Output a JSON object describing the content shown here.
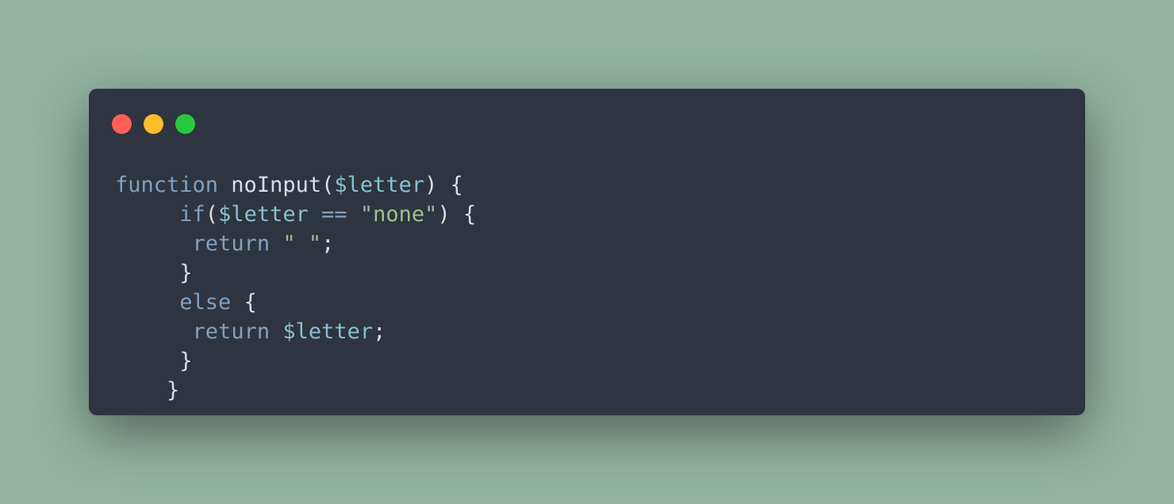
{
  "colors": {
    "background": "#94b3a2",
    "window": "#2e3440",
    "light_red": "#ff5f56",
    "light_yellow": "#ffbd2e",
    "light_green": "#27c93f",
    "keyword": "#81a1c1",
    "variable": "#88c0d0",
    "string": "#a3be8c",
    "plain": "#d8dee9"
  },
  "code": {
    "lines": [
      {
        "indent": "",
        "tokens": [
          {
            "t": "function",
            "k": "keyword"
          },
          {
            "t": " noInput(",
            "k": "plain"
          },
          {
            "t": "$letter",
            "k": "variable"
          },
          {
            "t": ") {",
            "k": "plain"
          }
        ]
      },
      {
        "indent": "     ",
        "tokens": [
          {
            "t": "if",
            "k": "keyword"
          },
          {
            "t": "(",
            "k": "plain"
          },
          {
            "t": "$letter",
            "k": "variable"
          },
          {
            "t": " ",
            "k": "plain"
          },
          {
            "t": "==",
            "k": "keyword"
          },
          {
            "t": " ",
            "k": "plain"
          },
          {
            "t": "\"none\"",
            "k": "string"
          },
          {
            "t": ") {",
            "k": "plain"
          }
        ]
      },
      {
        "indent": "      ",
        "tokens": [
          {
            "t": "return",
            "k": "keyword"
          },
          {
            "t": " ",
            "k": "plain"
          },
          {
            "t": "\" \"",
            "k": "string"
          },
          {
            "t": ";",
            "k": "plain"
          }
        ]
      },
      {
        "indent": "     ",
        "tokens": [
          {
            "t": "}",
            "k": "plain"
          }
        ]
      },
      {
        "indent": "     ",
        "tokens": [
          {
            "t": "else",
            "k": "keyword"
          },
          {
            "t": " {",
            "k": "plain"
          }
        ]
      },
      {
        "indent": "      ",
        "tokens": [
          {
            "t": "return",
            "k": "keyword"
          },
          {
            "t": " ",
            "k": "plain"
          },
          {
            "t": "$letter",
            "k": "variable"
          },
          {
            "t": ";",
            "k": "plain"
          }
        ]
      },
      {
        "indent": "     ",
        "tokens": [
          {
            "t": "}",
            "k": "plain"
          }
        ]
      },
      {
        "indent": "    ",
        "tokens": [
          {
            "t": "}",
            "k": "plain"
          }
        ]
      }
    ]
  }
}
